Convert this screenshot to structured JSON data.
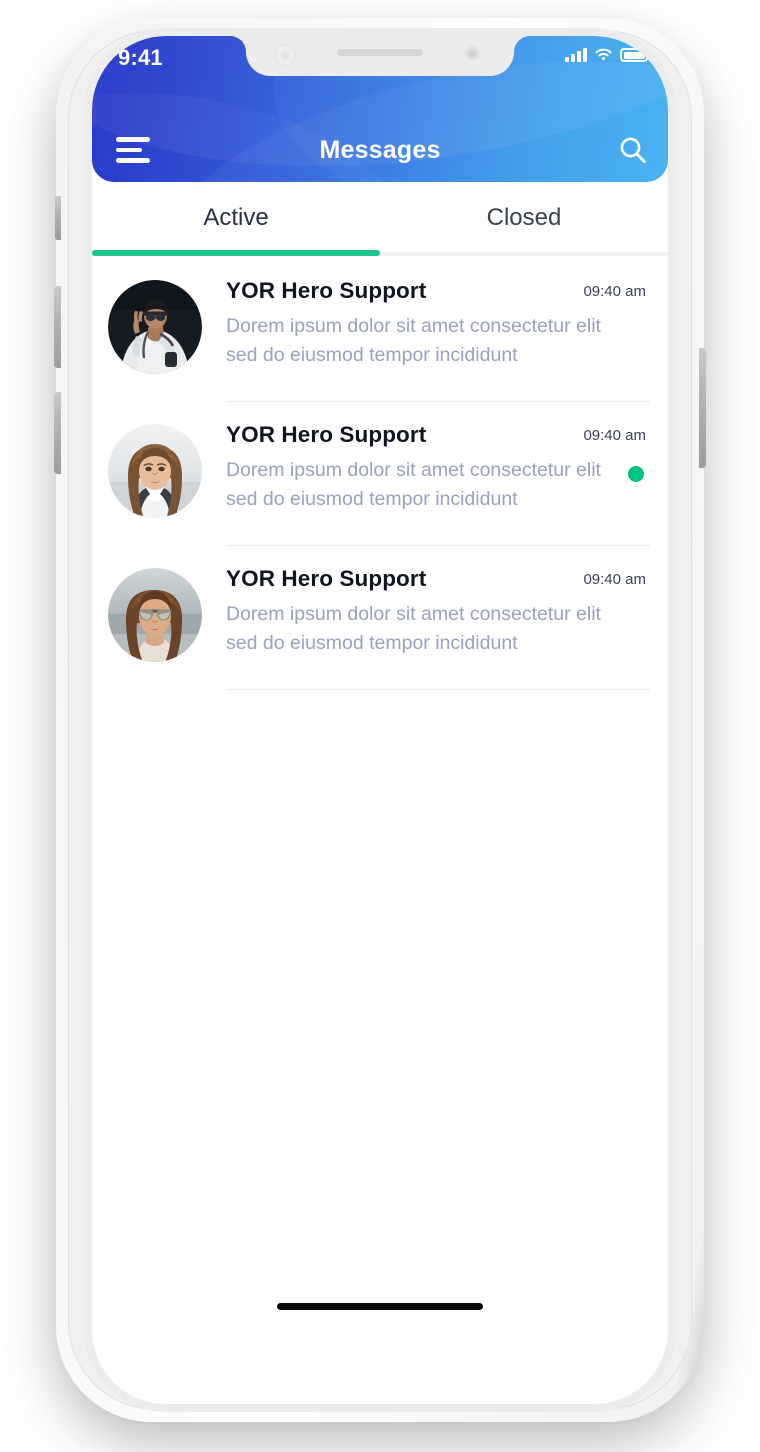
{
  "status_bar": {
    "time": "9:41",
    "signal_icon": "cellular-signal-icon",
    "wifi_icon": "wifi-icon",
    "battery_icon": "battery-icon"
  },
  "header": {
    "title": "Messages",
    "menu_icon": "hamburger-menu-icon",
    "search_icon": "search-icon",
    "gradient_start": "#2233c9",
    "gradient_end": "#3aadf2"
  },
  "tabs": {
    "active_index": 0,
    "underline_color": "#1ec68c",
    "items": [
      {
        "label": "Active"
      },
      {
        "label": "Closed"
      }
    ]
  },
  "messages": {
    "unread_dot_color": "#00c582",
    "items": [
      {
        "name": "YOR Hero Support",
        "time": "09:40 am",
        "preview": "Dorem ipsum dolor sit amet consectetur elit sed do eiusmod tempor incididunt",
        "avatar": "avatar-person-peace-sign",
        "unread": false
      },
      {
        "name": "YOR Hero Support",
        "time": "09:40 am",
        "preview": "Dorem ipsum dolor sit amet consectetur elit sed do eiusmod tempor incididunt",
        "avatar": "avatar-woman-long-hair",
        "unread": true
      },
      {
        "name": "YOR Hero Support",
        "time": "09:40 am",
        "preview": "Dorem ipsum dolor sit amet consectetur elit sed do eiusmod tempor incididunt",
        "avatar": "avatar-woman-sunglasses",
        "unread": false
      }
    ]
  },
  "home_indicator": {
    "label": "home-indicator"
  }
}
